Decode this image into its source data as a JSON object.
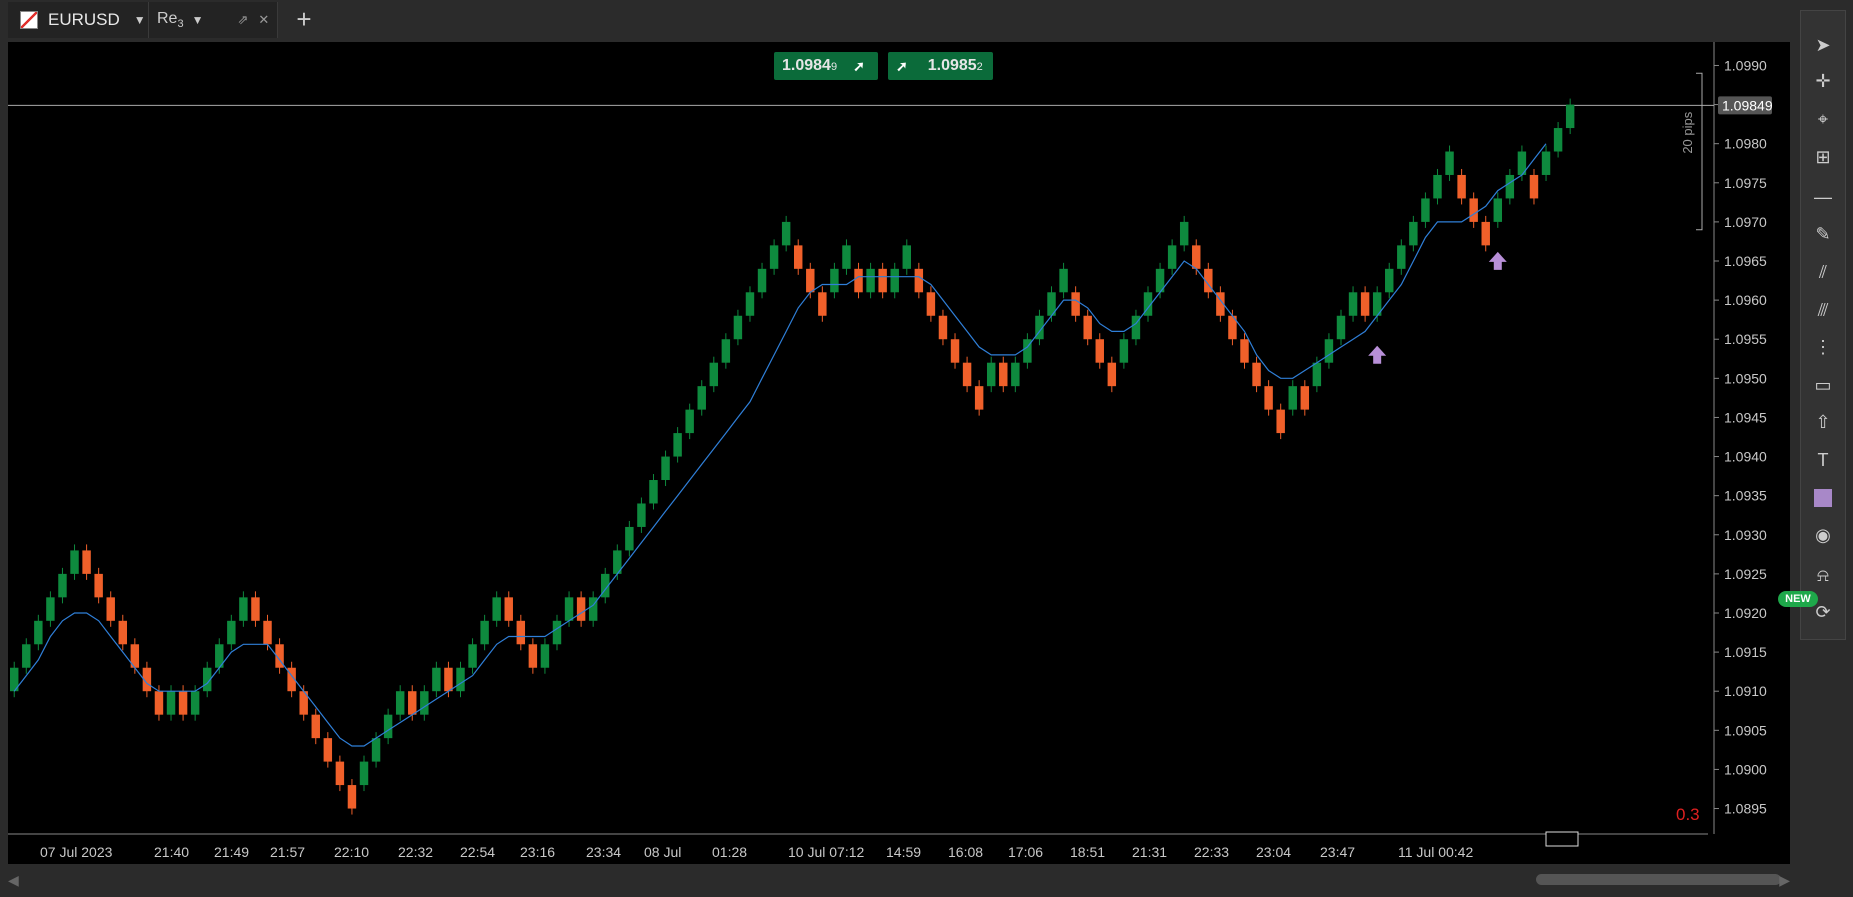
{
  "tabs": {
    "symbol": "EURUSD",
    "dropdown": "▼",
    "second": "Re",
    "second_sub": "3",
    "add": "+"
  },
  "price_badges": {
    "bid": "1.0984",
    "bid_sub": "9",
    "ask": "1.0985",
    "ask_sub": "2",
    "bid_arrow": "➚",
    "ask_arrow": "➚"
  },
  "toolbar_new": "NEW",
  "colors": {
    "background": "#000000",
    "bull": "#0e8a3e",
    "bear": "#f0602a",
    "ma": "#2f7fd8",
    "grid_text": "#c8c8c8",
    "signal_arrow": "#b88fd8"
  },
  "chart_data": {
    "type": "renko",
    "symbol": "EURUSD",
    "brick_size_pips": 5,
    "y_ticks": [
      "1.0990",
      "1.0985",
      "1.0980",
      "1.0975",
      "1.0970",
      "1.0965",
      "1.0960",
      "1.0955",
      "1.0950",
      "1.0945",
      "1.0940",
      "1.0935",
      "1.0930",
      "1.0925",
      "1.0920",
      "1.0915",
      "1.0910",
      "1.0905",
      "1.0900",
      "1.0895"
    ],
    "ylim": [
      1.0892,
      1.0993
    ],
    "current_price": "1.09849",
    "range_label": "20 pips",
    "corner_value": "0.3",
    "x_labels": [
      "07 Jul 2023",
      "21:40",
      "21:49",
      "21:57",
      "22:10",
      "22:32",
      "22:54",
      "23:16",
      "23:34",
      "08 Jul",
      "01:28",
      "10 Jul 07:12",
      "14:59",
      "16:08",
      "17:06",
      "18:51",
      "21:31",
      "22:33",
      "23:04",
      "23:47",
      "11 Jul 00:42"
    ],
    "bricks": [
      {
        "o": 1.091,
        "c": 1.0913
      },
      {
        "o": 1.0913,
        "c": 1.0916
      },
      {
        "o": 1.0916,
        "c": 1.0919
      },
      {
        "o": 1.0919,
        "c": 1.0922
      },
      {
        "o": 1.0922,
        "c": 1.0925
      },
      {
        "o": 1.0925,
        "c": 1.0928
      },
      {
        "o": 1.0928,
        "c": 1.0925
      },
      {
        "o": 1.0925,
        "c": 1.0922
      },
      {
        "o": 1.0922,
        "c": 1.0919
      },
      {
        "o": 1.0919,
        "c": 1.0916
      },
      {
        "o": 1.0916,
        "c": 1.0913
      },
      {
        "o": 1.0913,
        "c": 1.091
      },
      {
        "o": 1.091,
        "c": 1.0907
      },
      {
        "o": 1.0907,
        "c": 1.091
      },
      {
        "o": 1.091,
        "c": 1.0907
      },
      {
        "o": 1.0907,
        "c": 1.091
      },
      {
        "o": 1.091,
        "c": 1.0913
      },
      {
        "o": 1.0913,
        "c": 1.0916
      },
      {
        "o": 1.0916,
        "c": 1.0919
      },
      {
        "o": 1.0919,
        "c": 1.0922
      },
      {
        "o": 1.0922,
        "c": 1.0919
      },
      {
        "o": 1.0919,
        "c": 1.0916
      },
      {
        "o": 1.0916,
        "c": 1.0913
      },
      {
        "o": 1.0913,
        "c": 1.091
      },
      {
        "o": 1.091,
        "c": 1.0907
      },
      {
        "o": 1.0907,
        "c": 1.0904
      },
      {
        "o": 1.0904,
        "c": 1.0901
      },
      {
        "o": 1.0901,
        "c": 1.0898
      },
      {
        "o": 1.0898,
        "c": 1.0895
      },
      {
        "o": 1.0898,
        "c": 1.0901
      },
      {
        "o": 1.0901,
        "c": 1.0904
      },
      {
        "o": 1.0904,
        "c": 1.0907
      },
      {
        "o": 1.0907,
        "c": 1.091
      },
      {
        "o": 1.091,
        "c": 1.0907
      },
      {
        "o": 1.0907,
        "c": 1.091
      },
      {
        "o": 1.091,
        "c": 1.0913
      },
      {
        "o": 1.0913,
        "c": 1.091
      },
      {
        "o": 1.091,
        "c": 1.0913
      },
      {
        "o": 1.0913,
        "c": 1.0916
      },
      {
        "o": 1.0916,
        "c": 1.0919
      },
      {
        "o": 1.0919,
        "c": 1.0922
      },
      {
        "o": 1.0922,
        "c": 1.0919
      },
      {
        "o": 1.0919,
        "c": 1.0916
      },
      {
        "o": 1.0916,
        "c": 1.0913
      },
      {
        "o": 1.0913,
        "c": 1.0916
      },
      {
        "o": 1.0916,
        "c": 1.0919
      },
      {
        "o": 1.0919,
        "c": 1.0922
      },
      {
        "o": 1.0922,
        "c": 1.0919
      },
      {
        "o": 1.0919,
        "c": 1.0922
      },
      {
        "o": 1.0922,
        "c": 1.0925
      },
      {
        "o": 1.0925,
        "c": 1.0928
      },
      {
        "o": 1.0928,
        "c": 1.0931
      },
      {
        "o": 1.0931,
        "c": 1.0934
      },
      {
        "o": 1.0934,
        "c": 1.0937
      },
      {
        "o": 1.0937,
        "c": 1.094
      },
      {
        "o": 1.094,
        "c": 1.0943
      },
      {
        "o": 1.0943,
        "c": 1.0946
      },
      {
        "o": 1.0946,
        "c": 1.0949
      },
      {
        "o": 1.0949,
        "c": 1.0952
      },
      {
        "o": 1.0952,
        "c": 1.0955
      },
      {
        "o": 1.0955,
        "c": 1.0958
      },
      {
        "o": 1.0958,
        "c": 1.0961
      },
      {
        "o": 1.0961,
        "c": 1.0964
      },
      {
        "o": 1.0964,
        "c": 1.0967
      },
      {
        "o": 1.0967,
        "c": 1.097
      },
      {
        "o": 1.0967,
        "c": 1.0964
      },
      {
        "o": 1.0964,
        "c": 1.0961
      },
      {
        "o": 1.0961,
        "c": 1.0958
      },
      {
        "o": 1.0961,
        "c": 1.0964
      },
      {
        "o": 1.0964,
        "c": 1.0967
      },
      {
        "o": 1.0964,
        "c": 1.0961
      },
      {
        "o": 1.0961,
        "c": 1.0964
      },
      {
        "o": 1.0964,
        "c": 1.0961
      },
      {
        "o": 1.0961,
        "c": 1.0964
      },
      {
        "o": 1.0964,
        "c": 1.0967
      },
      {
        "o": 1.0964,
        "c": 1.0961
      },
      {
        "o": 1.0961,
        "c": 1.0958
      },
      {
        "o": 1.0958,
        "c": 1.0955
      },
      {
        "o": 1.0955,
        "c": 1.0952
      },
      {
        "o": 1.0952,
        "c": 1.0949
      },
      {
        "o": 1.0949,
        "c": 1.0946
      },
      {
        "o": 1.0949,
        "c": 1.0952
      },
      {
        "o": 1.0952,
        "c": 1.0949
      },
      {
        "o": 1.0949,
        "c": 1.0952
      },
      {
        "o": 1.0952,
        "c": 1.0955
      },
      {
        "o": 1.0955,
        "c": 1.0958
      },
      {
        "o": 1.0958,
        "c": 1.0961
      },
      {
        "o": 1.0961,
        "c": 1.0964
      },
      {
        "o": 1.0961,
        "c": 1.0958
      },
      {
        "o": 1.0958,
        "c": 1.0955
      },
      {
        "o": 1.0955,
        "c": 1.0952
      },
      {
        "o": 1.0952,
        "c": 1.0949
      },
      {
        "o": 1.0952,
        "c": 1.0955
      },
      {
        "o": 1.0955,
        "c": 1.0958
      },
      {
        "o": 1.0958,
        "c": 1.0961
      },
      {
        "o": 1.0961,
        "c": 1.0964
      },
      {
        "o": 1.0964,
        "c": 1.0967
      },
      {
        "o": 1.0967,
        "c": 1.097
      },
      {
        "o": 1.0967,
        "c": 1.0964
      },
      {
        "o": 1.0964,
        "c": 1.0961
      },
      {
        "o": 1.0961,
        "c": 1.0958
      },
      {
        "o": 1.0958,
        "c": 1.0955
      },
      {
        "o": 1.0955,
        "c": 1.0952
      },
      {
        "o": 1.0952,
        "c": 1.0949
      },
      {
        "o": 1.0949,
        "c": 1.0946
      },
      {
        "o": 1.0946,
        "c": 1.0943
      },
      {
        "o": 1.0946,
        "c": 1.0949
      },
      {
        "o": 1.0949,
        "c": 1.0946
      },
      {
        "o": 1.0949,
        "c": 1.0952
      },
      {
        "o": 1.0952,
        "c": 1.0955
      },
      {
        "o": 1.0955,
        "c": 1.0958
      },
      {
        "o": 1.0958,
        "c": 1.0961
      },
      {
        "o": 1.0961,
        "c": 1.0958
      },
      {
        "o": 1.0958,
        "c": 1.0961
      },
      {
        "o": 1.0961,
        "c": 1.0964
      },
      {
        "o": 1.0964,
        "c": 1.0967
      },
      {
        "o": 1.0967,
        "c": 1.097
      },
      {
        "o": 1.097,
        "c": 1.0973
      },
      {
        "o": 1.0973,
        "c": 1.0976
      },
      {
        "o": 1.0976,
        "c": 1.0979
      },
      {
        "o": 1.0976,
        "c": 1.0973
      },
      {
        "o": 1.0973,
        "c": 1.097
      },
      {
        "o": 1.097,
        "c": 1.0967
      },
      {
        "o": 1.097,
        "c": 1.0973
      },
      {
        "o": 1.0973,
        "c": 1.0976
      },
      {
        "o": 1.0976,
        "c": 1.0979
      },
      {
        "o": 1.0976,
        "c": 1.0973
      },
      {
        "o": 1.0976,
        "c": 1.0979
      },
      {
        "o": 1.0979,
        "c": 1.0982
      },
      {
        "o": 1.0982,
        "c": 1.0985
      }
    ],
    "moving_average": [
      1.091,
      1.0912,
      1.0914,
      1.0917,
      1.0919,
      1.092,
      1.092,
      1.0919,
      1.0917,
      1.0915,
      1.0913,
      1.0911,
      1.091,
      1.091,
      1.091,
      1.091,
      1.0911,
      1.0913,
      1.0915,
      1.0916,
      1.0916,
      1.0916,
      1.0914,
      1.0912,
      1.091,
      1.0908,
      1.0906,
      1.0904,
      1.0903,
      1.0903,
      1.0904,
      1.0905,
      1.0906,
      1.0907,
      1.0908,
      1.0909,
      1.091,
      1.0911,
      1.0912,
      1.0914,
      1.0916,
      1.0917,
      1.0917,
      1.0917,
      1.0917,
      1.0918,
      1.0919,
      1.092,
      1.0921,
      1.0923,
      1.0925,
      1.0927,
      1.0929,
      1.0931,
      1.0933,
      1.0935,
      1.0937,
      1.0939,
      1.0941,
      1.0943,
      1.0945,
      1.0947,
      1.095,
      1.0953,
      1.0956,
      1.0959,
      1.0961,
      1.0962,
      1.0962,
      1.0962,
      1.0963,
      1.0963,
      1.0963,
      1.0963,
      1.0963,
      1.0963,
      1.0962,
      1.096,
      1.0958,
      1.0956,
      1.0954,
      1.0953,
      1.0953,
      1.0953,
      1.0954,
      1.0956,
      1.0958,
      1.096,
      1.096,
      1.0959,
      1.0957,
      1.0956,
      1.0956,
      1.0957,
      1.0959,
      1.0961,
      1.0963,
      1.0965,
      1.0964,
      1.0962,
      1.096,
      1.0958,
      1.0956,
      1.0953,
      1.0951,
      1.095,
      1.095,
      1.0951,
      1.0952,
      1.0953,
      1.0954,
      1.0955,
      1.0956,
      1.0958,
      1.096,
      1.0962,
      1.0965,
      1.0968,
      1.097,
      1.097,
      1.097,
      1.0971,
      1.0972,
      1.0974,
      1.0975,
      1.0976,
      1.0978,
      1.098
    ],
    "signals": [
      {
        "brick_index": 113
      },
      {
        "brick_index": 123
      }
    ]
  }
}
